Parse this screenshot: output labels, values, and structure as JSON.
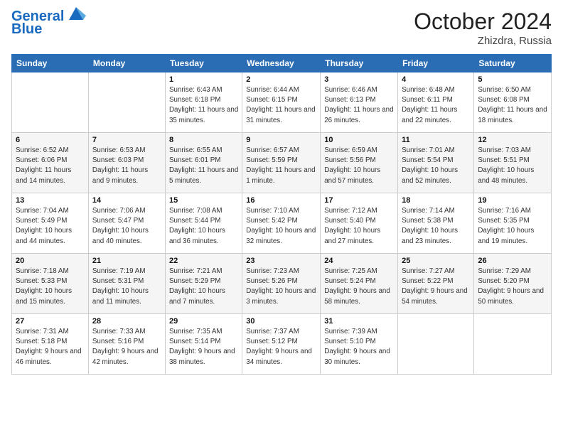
{
  "header": {
    "logo_line1": "General",
    "logo_line2": "Blue",
    "month": "October 2024",
    "location": "Zhizdra, Russia"
  },
  "days_of_week": [
    "Sunday",
    "Monday",
    "Tuesday",
    "Wednesday",
    "Thursday",
    "Friday",
    "Saturday"
  ],
  "weeks": [
    [
      {
        "day": "",
        "sunrise": "",
        "sunset": "",
        "daylight": ""
      },
      {
        "day": "",
        "sunrise": "",
        "sunset": "",
        "daylight": ""
      },
      {
        "day": "1",
        "sunrise": "Sunrise: 6:43 AM",
        "sunset": "Sunset: 6:18 PM",
        "daylight": "Daylight: 11 hours and 35 minutes."
      },
      {
        "day": "2",
        "sunrise": "Sunrise: 6:44 AM",
        "sunset": "Sunset: 6:15 PM",
        "daylight": "Daylight: 11 hours and 31 minutes."
      },
      {
        "day": "3",
        "sunrise": "Sunrise: 6:46 AM",
        "sunset": "Sunset: 6:13 PM",
        "daylight": "Daylight: 11 hours and 26 minutes."
      },
      {
        "day": "4",
        "sunrise": "Sunrise: 6:48 AM",
        "sunset": "Sunset: 6:11 PM",
        "daylight": "Daylight: 11 hours and 22 minutes."
      },
      {
        "day": "5",
        "sunrise": "Sunrise: 6:50 AM",
        "sunset": "Sunset: 6:08 PM",
        "daylight": "Daylight: 11 hours and 18 minutes."
      }
    ],
    [
      {
        "day": "6",
        "sunrise": "Sunrise: 6:52 AM",
        "sunset": "Sunset: 6:06 PM",
        "daylight": "Daylight: 11 hours and 14 minutes."
      },
      {
        "day": "7",
        "sunrise": "Sunrise: 6:53 AM",
        "sunset": "Sunset: 6:03 PM",
        "daylight": "Daylight: 11 hours and 9 minutes."
      },
      {
        "day": "8",
        "sunrise": "Sunrise: 6:55 AM",
        "sunset": "Sunset: 6:01 PM",
        "daylight": "Daylight: 11 hours and 5 minutes."
      },
      {
        "day": "9",
        "sunrise": "Sunrise: 6:57 AM",
        "sunset": "Sunset: 5:59 PM",
        "daylight": "Daylight: 11 hours and 1 minute."
      },
      {
        "day": "10",
        "sunrise": "Sunrise: 6:59 AM",
        "sunset": "Sunset: 5:56 PM",
        "daylight": "Daylight: 10 hours and 57 minutes."
      },
      {
        "day": "11",
        "sunrise": "Sunrise: 7:01 AM",
        "sunset": "Sunset: 5:54 PM",
        "daylight": "Daylight: 10 hours and 52 minutes."
      },
      {
        "day": "12",
        "sunrise": "Sunrise: 7:03 AM",
        "sunset": "Sunset: 5:51 PM",
        "daylight": "Daylight: 10 hours and 48 minutes."
      }
    ],
    [
      {
        "day": "13",
        "sunrise": "Sunrise: 7:04 AM",
        "sunset": "Sunset: 5:49 PM",
        "daylight": "Daylight: 10 hours and 44 minutes."
      },
      {
        "day": "14",
        "sunrise": "Sunrise: 7:06 AM",
        "sunset": "Sunset: 5:47 PM",
        "daylight": "Daylight: 10 hours and 40 minutes."
      },
      {
        "day": "15",
        "sunrise": "Sunrise: 7:08 AM",
        "sunset": "Sunset: 5:44 PM",
        "daylight": "Daylight: 10 hours and 36 minutes."
      },
      {
        "day": "16",
        "sunrise": "Sunrise: 7:10 AM",
        "sunset": "Sunset: 5:42 PM",
        "daylight": "Daylight: 10 hours and 32 minutes."
      },
      {
        "day": "17",
        "sunrise": "Sunrise: 7:12 AM",
        "sunset": "Sunset: 5:40 PM",
        "daylight": "Daylight: 10 hours and 27 minutes."
      },
      {
        "day": "18",
        "sunrise": "Sunrise: 7:14 AM",
        "sunset": "Sunset: 5:38 PM",
        "daylight": "Daylight: 10 hours and 23 minutes."
      },
      {
        "day": "19",
        "sunrise": "Sunrise: 7:16 AM",
        "sunset": "Sunset: 5:35 PM",
        "daylight": "Daylight: 10 hours and 19 minutes."
      }
    ],
    [
      {
        "day": "20",
        "sunrise": "Sunrise: 7:18 AM",
        "sunset": "Sunset: 5:33 PM",
        "daylight": "Daylight: 10 hours and 15 minutes."
      },
      {
        "day": "21",
        "sunrise": "Sunrise: 7:19 AM",
        "sunset": "Sunset: 5:31 PM",
        "daylight": "Daylight: 10 hours and 11 minutes."
      },
      {
        "day": "22",
        "sunrise": "Sunrise: 7:21 AM",
        "sunset": "Sunset: 5:29 PM",
        "daylight": "Daylight: 10 hours and 7 minutes."
      },
      {
        "day": "23",
        "sunrise": "Sunrise: 7:23 AM",
        "sunset": "Sunset: 5:26 PM",
        "daylight": "Daylight: 10 hours and 3 minutes."
      },
      {
        "day": "24",
        "sunrise": "Sunrise: 7:25 AM",
        "sunset": "Sunset: 5:24 PM",
        "daylight": "Daylight: 9 hours and 58 minutes."
      },
      {
        "day": "25",
        "sunrise": "Sunrise: 7:27 AM",
        "sunset": "Sunset: 5:22 PM",
        "daylight": "Daylight: 9 hours and 54 minutes."
      },
      {
        "day": "26",
        "sunrise": "Sunrise: 7:29 AM",
        "sunset": "Sunset: 5:20 PM",
        "daylight": "Daylight: 9 hours and 50 minutes."
      }
    ],
    [
      {
        "day": "27",
        "sunrise": "Sunrise: 7:31 AM",
        "sunset": "Sunset: 5:18 PM",
        "daylight": "Daylight: 9 hours and 46 minutes."
      },
      {
        "day": "28",
        "sunrise": "Sunrise: 7:33 AM",
        "sunset": "Sunset: 5:16 PM",
        "daylight": "Daylight: 9 hours and 42 minutes."
      },
      {
        "day": "29",
        "sunrise": "Sunrise: 7:35 AM",
        "sunset": "Sunset: 5:14 PM",
        "daylight": "Daylight: 9 hours and 38 minutes."
      },
      {
        "day": "30",
        "sunrise": "Sunrise: 7:37 AM",
        "sunset": "Sunset: 5:12 PM",
        "daylight": "Daylight: 9 hours and 34 minutes."
      },
      {
        "day": "31",
        "sunrise": "Sunrise: 7:39 AM",
        "sunset": "Sunset: 5:10 PM",
        "daylight": "Daylight: 9 hours and 30 minutes."
      },
      {
        "day": "",
        "sunrise": "",
        "sunset": "",
        "daylight": ""
      },
      {
        "day": "",
        "sunrise": "",
        "sunset": "",
        "daylight": ""
      }
    ]
  ]
}
